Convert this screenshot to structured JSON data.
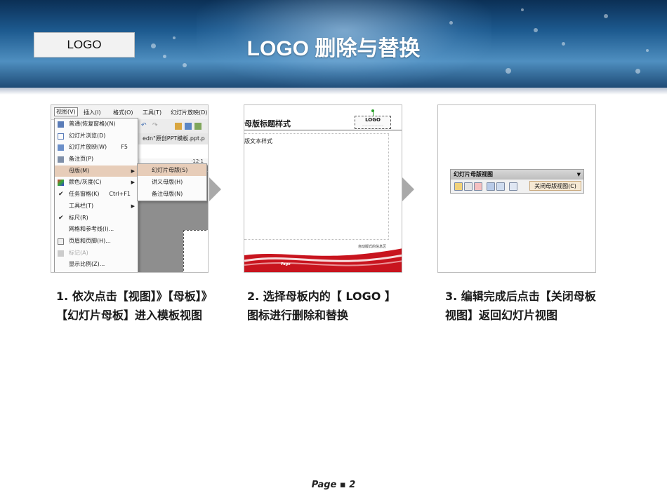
{
  "header": {
    "logo_label": "LOGO",
    "title": "LOGO 删除与替换"
  },
  "panel1": {
    "menubar": [
      "视图(V)",
      "插入(I)",
      "格式(O)",
      "工具(T)",
      "幻灯片放映(D)"
    ],
    "file_title": "edn\"原创PPT模板.ppt.p",
    "ruler_text": "·12·1",
    "menu_items": [
      {
        "label": "普通(恢复窗格)(N)",
        "shortcut": "",
        "submenu": false,
        "icon": "normal-view-icon"
      },
      {
        "label": "幻灯片浏览(D)",
        "shortcut": "",
        "submenu": false,
        "icon": "slide-sorter-icon"
      },
      {
        "label": "幻灯片放映(W)",
        "shortcut": "F5",
        "submenu": false,
        "icon": "slideshow-icon"
      },
      {
        "label": "备注页(P)",
        "shortcut": "",
        "submenu": false,
        "icon": "notes-page-icon"
      },
      {
        "label": "母版(M)",
        "shortcut": "",
        "submenu": true,
        "icon": ""
      },
      {
        "label": "颜色/灰度(C)",
        "shortcut": "",
        "submenu": true,
        "icon": "color-grayscale-icon"
      },
      {
        "label": "任务窗格(K)",
        "shortcut": "Ctrl+F1",
        "submenu": false,
        "icon": "checkmark-icon"
      },
      {
        "label": "工具栏(T)",
        "shortcut": "",
        "submenu": true,
        "icon": ""
      },
      {
        "label": "标尺(R)",
        "shortcut": "",
        "submenu": false,
        "icon": "checkmark-icon"
      },
      {
        "label": "网格和参考线(I)...",
        "shortcut": "",
        "submenu": false,
        "icon": ""
      },
      {
        "label": "页眉和页脚(H)...",
        "shortcut": "",
        "submenu": false,
        "icon": "header-footer-icon"
      },
      {
        "label": "标记(A)",
        "shortcut": "",
        "submenu": false,
        "icon": "markup-icon"
      },
      {
        "label": "显示比例(Z)...",
        "shortcut": "",
        "submenu": false,
        "icon": ""
      }
    ],
    "submenu_items": [
      "幻灯片母版(S)",
      "讲义母版(H)",
      "备注母版(N)"
    ]
  },
  "panel2": {
    "slide_title": "母版标题样式",
    "body_text": "版文本样式",
    "logo_text": "LOGO",
    "small_text": "自动版式的信息区",
    "page_text": "Page"
  },
  "panel3": {
    "toolbar_title": "幻灯片母版视图",
    "close_button": "关闭母版视图(C)"
  },
  "captions": {
    "step1": "1. 依次点击【视图】》【母板】》【幻灯片母板】进入模板视图",
    "step2": "2. 选择母板内的【 LOGO 】图标进行删除和替换",
    "step3": "3. 编辑完成后点击【关闭母板视图】返回幻灯片视图"
  },
  "footer": {
    "page": "Page ▪ 2"
  },
  "colors": {
    "header_dark": "#0b2f55",
    "header_light": "#4f8fc0",
    "menu_highlight": "#e7cdb9",
    "wave_red": "#c8141e",
    "arrow_gray": "#a9a9a9"
  }
}
